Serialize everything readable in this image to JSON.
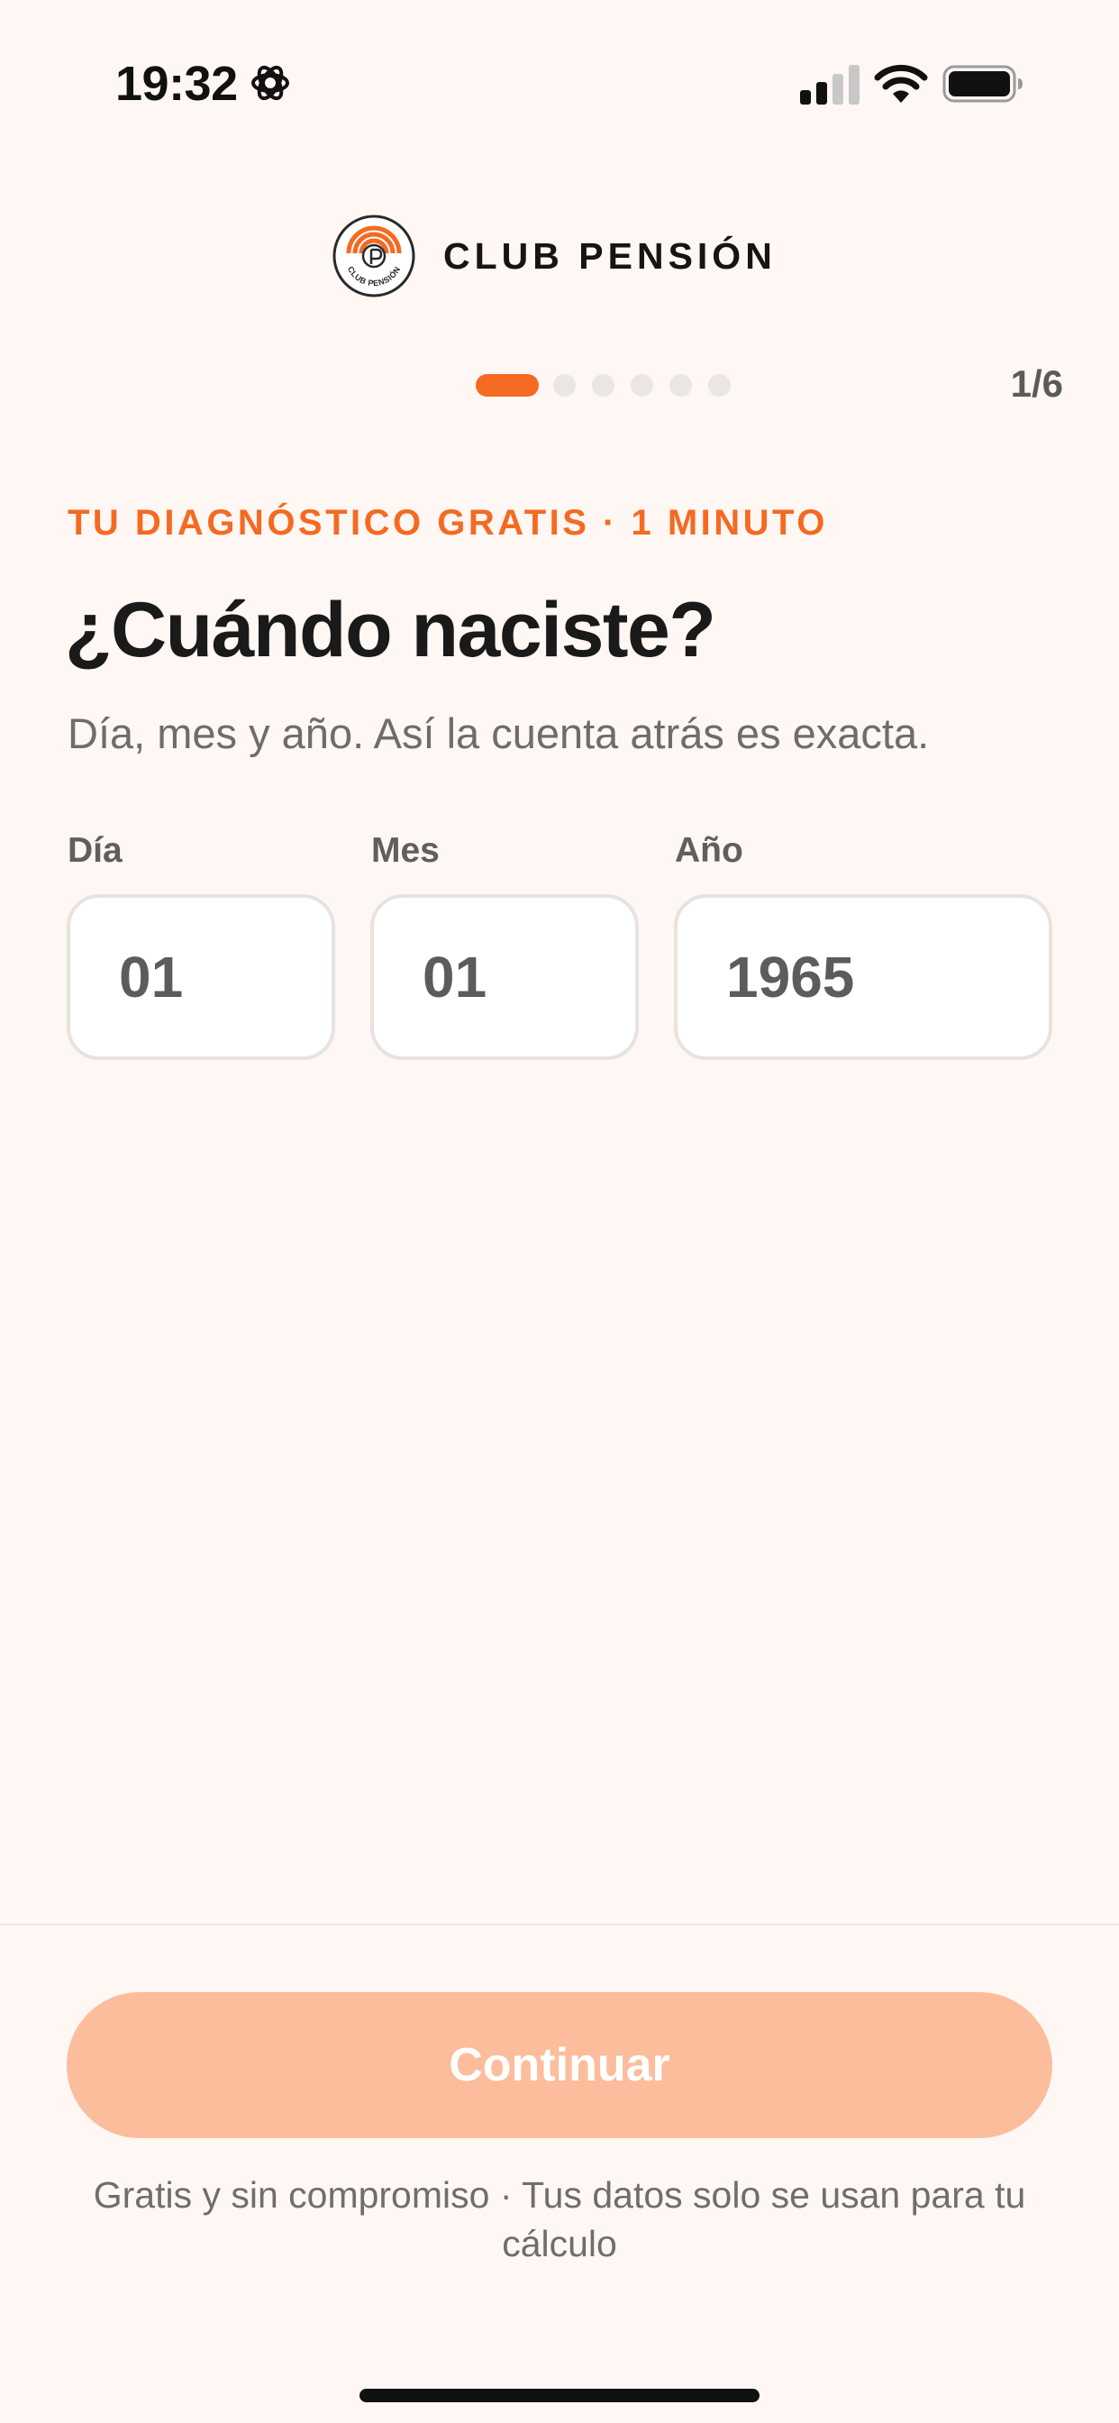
{
  "status_bar": {
    "time": "19:32",
    "icons": [
      "gear-icon",
      "signal-icon",
      "wifi-icon",
      "battery-icon"
    ]
  },
  "brand": {
    "name": "CLUB PENSIÓN",
    "logo_icon": "club-pension-logo",
    "logo_text": "CLUB PENSIÓN",
    "accent_color": "#F46A22"
  },
  "progress": {
    "current_step": 1,
    "total_steps": 6,
    "label": "1/6"
  },
  "content": {
    "eyebrow": "TU DIAGNÓSTICO GRATIS · 1 MINUTO",
    "title": "¿Cuándo naciste?",
    "subtitle": "Día, mes y año. Así la cuenta atrás es exacta."
  },
  "fields": {
    "day": {
      "label": "Día",
      "value": "01"
    },
    "month": {
      "label": "Mes",
      "value": "01"
    },
    "year": {
      "label": "Año",
      "value": "1965"
    }
  },
  "footer": {
    "continue_label": "Continuar",
    "note": "Gratis y sin compromiso · Tus datos solo se usan para tu cálculo"
  },
  "colors": {
    "background": "#FFF7F4",
    "accent": "#F46A22",
    "button_disabled": "#FBBD9B"
  }
}
